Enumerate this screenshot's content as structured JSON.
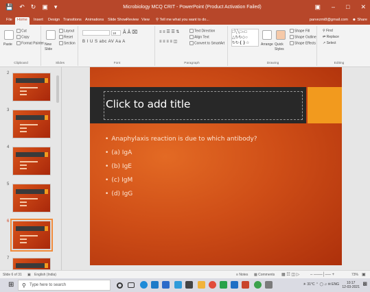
{
  "window": {
    "title": "Microbiology MCQ CRIT - PowerPoint (Product Activation Failed)",
    "quick_access": [
      "save",
      "undo",
      "redo",
      "start-from-beginning",
      "customize"
    ],
    "controls": [
      "ribbon-display",
      "minimize",
      "maximize",
      "close"
    ]
  },
  "tabs": {
    "items": [
      "File",
      "Home",
      "Insert",
      "Design",
      "Transitions",
      "Animations",
      "Slide Show",
      "Review",
      "View"
    ],
    "active": "Home",
    "tell_me": "Tell me what you want to do...",
    "account": "parvezmi8@gmail.com",
    "share": "Share"
  },
  "ribbon": {
    "clipboard": {
      "paste": "Paste",
      "cut": "Cut",
      "copy": "Copy",
      "format_painter": "Format Painter",
      "label": "Clipboard"
    },
    "slides": {
      "new_slide": "New Slide",
      "layout": "Layout",
      "reset": "Reset",
      "section": "Section",
      "label": "Slides"
    },
    "font": {
      "size": "18",
      "label": "Font",
      "row2": "B  I  U  S  abc  AV  Aa  A"
    },
    "paragraph": {
      "text_direction": "Text Direction",
      "align_text": "Align Text",
      "convert_smartart": "Convert to SmartArt",
      "label": "Paragraph"
    },
    "drawing": {
      "arrange": "Arrange",
      "quick_styles": "Quick Styles",
      "shape_fill": "Shape Fill",
      "shape_outline": "Shape Outline",
      "shape_effects": "Shape Effects",
      "label": "Drawing"
    },
    "editing": {
      "find": "Find",
      "replace": "Replace",
      "select": "Select",
      "label": "Editing"
    }
  },
  "thumbnails": {
    "items": [
      {
        "number": "2",
        "selected": false
      },
      {
        "number": "3",
        "selected": false
      },
      {
        "number": "4",
        "selected": false
      },
      {
        "number": "5",
        "selected": false
      },
      {
        "number": "6",
        "selected": true
      },
      {
        "number": "7",
        "selected": false
      }
    ]
  },
  "slide": {
    "title_placeholder": "Click to add title",
    "bullets": [
      "Anaphylaxis reaction is due to which antibody?",
      "(a) IgA",
      "(b) IgE",
      "(c) IgM",
      "(d) IgG"
    ],
    "colors": {
      "background": "#cf4e17",
      "title_bar": "#282828",
      "accent": "#f29a1e"
    }
  },
  "statusbar": {
    "slide_count": "Slide 6 of 31",
    "language": "English (India)",
    "notes": "Notes",
    "comments": "Comments",
    "zoom": "73%"
  },
  "taskbar": {
    "search_placeholder": "Type here to search",
    "weather": "31°C",
    "lang": "ENG",
    "time": "10:17",
    "date": "12-03-2021"
  }
}
